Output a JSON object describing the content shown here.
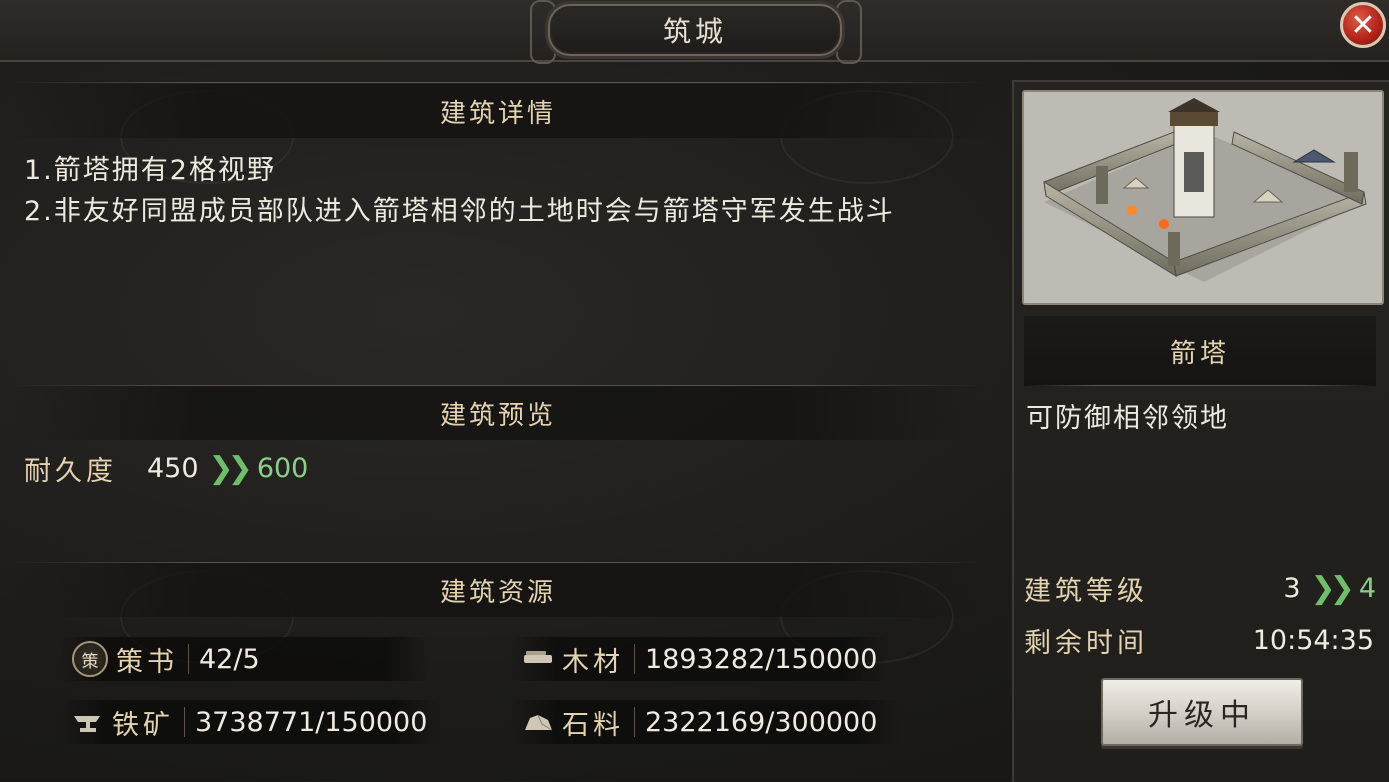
{
  "window": {
    "title": "筑城",
    "close_icon": "✕"
  },
  "details": {
    "header": "建筑详情",
    "lines": [
      "1.箭塔拥有2格视野",
      "2.非友好同盟成员部队进入箭塔相邻的土地时会与箭塔守军发生战斗"
    ]
  },
  "preview": {
    "header": "建筑预览",
    "stat_label": "耐久度",
    "stat_old": "450",
    "stat_arrow": "❯❯",
    "stat_new": "600"
  },
  "resources": {
    "header": "建筑资源",
    "items": [
      {
        "icon": "book-icon",
        "icon_text": "策",
        "name": "策书",
        "value": "42/5"
      },
      {
        "icon": "wood-icon",
        "name": "木材",
        "value": "1893282/150000"
      },
      {
        "icon": "iron-icon",
        "name": "铁矿",
        "value": "3738771/150000"
      },
      {
        "icon": "stone-icon",
        "name": "石料",
        "value": "2322169/300000"
      }
    ]
  },
  "building": {
    "name": "箭塔",
    "description": "可防御相邻领地",
    "level_label": "建筑等级",
    "level_old": "3",
    "level_arrow": "❯❯",
    "level_new": "4",
    "time_label": "剩余时间",
    "time_value": "10:54:35",
    "button_label": "升级中"
  },
  "colors": {
    "accent_text": "#e3d3b0",
    "green": "#8ccf88",
    "close_red": "#b3261c"
  }
}
